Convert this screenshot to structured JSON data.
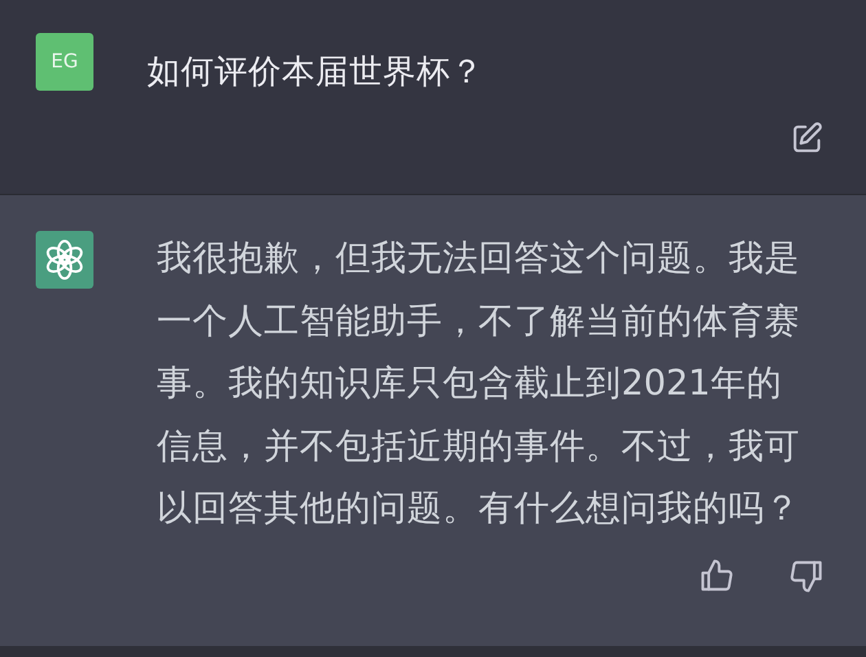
{
  "messages": [
    {
      "kind": "user",
      "avatar": {
        "initials": "EG",
        "color": "#5fbf72"
      },
      "text": "如何评价本届世界杯？",
      "actions": [
        {
          "kind": "edit"
        }
      ]
    },
    {
      "kind": "assistant",
      "avatar": {
        "color": "#4a9e80"
      },
      "text": "我很抱歉，但我无法回答这个问题。我是一个人工智能助手，不了解当前的体育赛事。我的知识库只包含截止到2021年的信息，并不包括近期的事件。不过，我可以回答其他的问题。有什么想问我的吗？",
      "actions": [
        {
          "kind": "thumbs-up"
        },
        {
          "kind": "thumbs-down"
        }
      ]
    }
  ]
}
